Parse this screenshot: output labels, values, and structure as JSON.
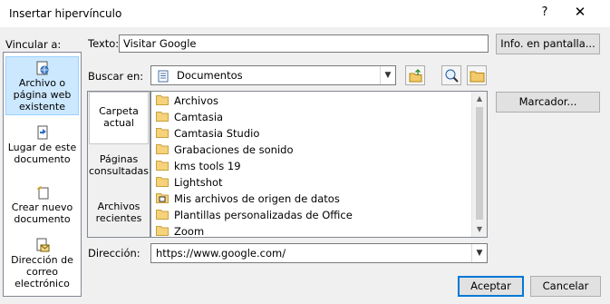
{
  "window": {
    "title": "Insertar hipervínculo",
    "help_glyph": "?",
    "close_glyph": "✕"
  },
  "link_to": {
    "label": "Vincular a:",
    "items": [
      {
        "label": "Archivo o página web existente",
        "icon": "web-page-icon",
        "selected": true
      },
      {
        "label": "Lugar de este documento",
        "icon": "document-place-icon",
        "selected": false
      },
      {
        "label": "Crear nuevo documento",
        "icon": "new-document-icon",
        "selected": false
      },
      {
        "label": "Dirección de correo electrónico",
        "icon": "email-icon",
        "selected": false
      }
    ]
  },
  "text_field": {
    "label": "Texto:",
    "value": "Visitar Google"
  },
  "screentip_button": "Info. en pantalla...",
  "look_in": {
    "label": "Buscar en:",
    "value": "Documentos",
    "icons": [
      "up-folder-icon",
      "browse-web-icon",
      "browse-file-icon"
    ]
  },
  "places": {
    "items": [
      {
        "label": "Carpeta actual",
        "selected": true
      },
      {
        "label": "Páginas consultadas",
        "selected": false
      },
      {
        "label": "Archivos recientes",
        "selected": false
      }
    ]
  },
  "files": [
    {
      "name": "Archivos",
      "icon": "folder-icon"
    },
    {
      "name": "Camtasia",
      "icon": "folder-icon"
    },
    {
      "name": "Camtasia Studio",
      "icon": "folder-icon"
    },
    {
      "name": "Grabaciones de sonido",
      "icon": "folder-icon"
    },
    {
      "name": "kms tools 19",
      "icon": "folder-icon"
    },
    {
      "name": "Lightshot",
      "icon": "folder-icon"
    },
    {
      "name": "Mis archivos de origen de datos",
      "icon": "data-source-folder-icon"
    },
    {
      "name": "Plantillas personalizadas de Office",
      "icon": "folder-icon"
    },
    {
      "name": "Zoom",
      "icon": "folder-icon"
    }
  ],
  "bookmark_button": "Marcador...",
  "address": {
    "label": "Dirección:",
    "value": "https://www.google.com/"
  },
  "ok_button": "Aceptar",
  "cancel_button": "Cancelar"
}
